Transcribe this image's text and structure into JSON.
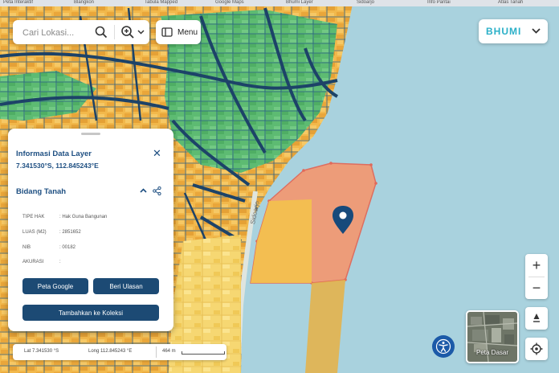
{
  "browser": {
    "tabs": [
      "Peta Interaktif",
      "Blangkon",
      "Tabula Mapped",
      "Google Maps",
      "Bhumi Layer",
      "Sidoarjo",
      "Info Pantai",
      "Atlas Tanah",
      "Basemap"
    ]
  },
  "map": {
    "road_label": "Sidoarjo",
    "colors": {
      "sea": "#a9d2de",
      "road": "#1d4368",
      "parcel_orange": "#f2b84b",
      "parcel_green": "#5dbb72",
      "selected_parcel": "#f19a74",
      "light_parcel": "#f6d772",
      "marker": "#174a7b"
    }
  },
  "search": {
    "placeholder": "Cari Lokasi...",
    "search_icon": "search-icon",
    "zoom_icon": "zoom-in-icon"
  },
  "menu": {
    "label": "Menu"
  },
  "brand": {
    "name": "BHUMI"
  },
  "panel": {
    "title": "Informasi Data Layer",
    "coords": "7.341530°S, 112.845243°E",
    "section_title": "Bidang Tanah",
    "attributes": [
      {
        "label": "TIPE HAK",
        "value": ": Hak Guna Bangunan"
      },
      {
        "label": "LUAS (M2)",
        "value": ": 2851652"
      },
      {
        "label": "NIB",
        "value": ": 00182"
      },
      {
        "label": "AKURASI",
        "value": ":"
      }
    ],
    "buttons": {
      "peta_google": "Peta Google",
      "beri_ulasan": "Beri Ulasan",
      "tambahkan": "Tambahkan ke Koleksi"
    }
  },
  "scale": {
    "lat": "Lat 7.341530 °S",
    "long": "Long 112.845243 °E",
    "scale_label": "464 m"
  },
  "controls": {
    "zoom_in": "+",
    "zoom_out": "−",
    "basemap_label": "Peta Dasar"
  }
}
